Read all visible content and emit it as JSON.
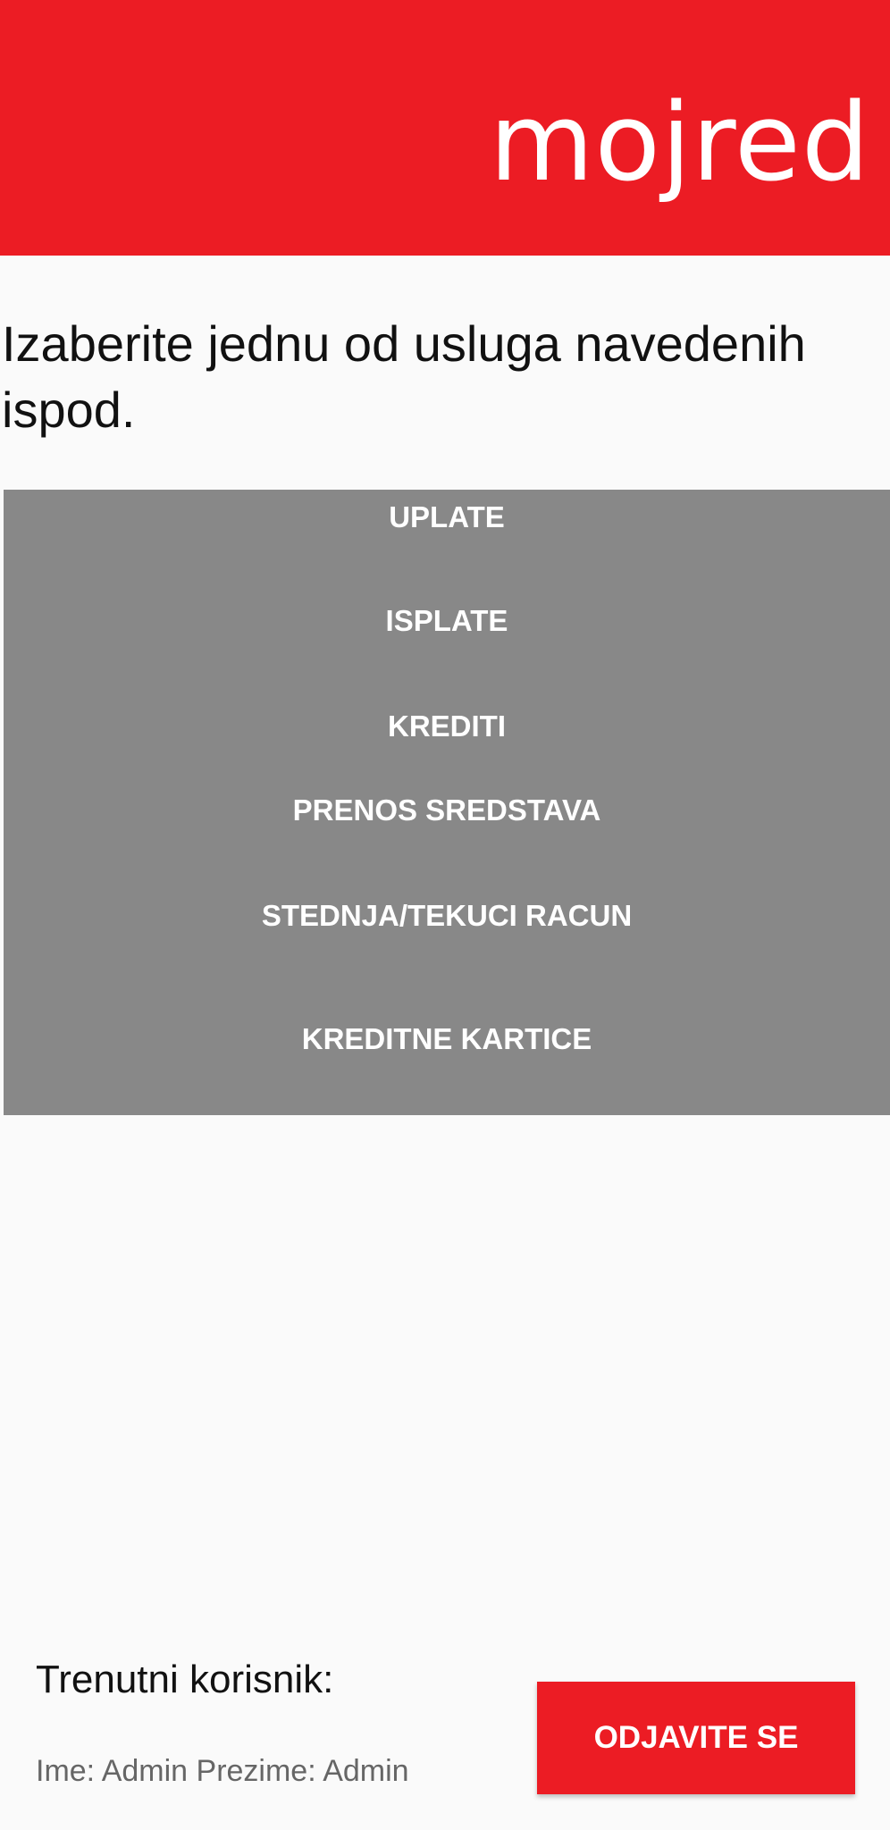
{
  "colors": {
    "brand": "#ec1c24",
    "menu_bg": "#888888",
    "page_bg": "#fafafa"
  },
  "header": {
    "logo_text": "mojred"
  },
  "main": {
    "prompt": "Izaberite  jednu od usluga navedenih ispod.",
    "menu_items": [
      {
        "label": "UPLATE"
      },
      {
        "label": "ISPLATE"
      },
      {
        "label": "KREDITI"
      },
      {
        "label": "PRENOS SREDSTAVA"
      },
      {
        "label": "STEDNJA/TEKUCI RACUN"
      },
      {
        "label": "KREDITNE KARTICE"
      }
    ]
  },
  "footer": {
    "user_title": "Trenutni korisnik:",
    "user_info": "Ime: Admin Prezime: Admin",
    "logout_label": "ODJAVITE SE"
  }
}
